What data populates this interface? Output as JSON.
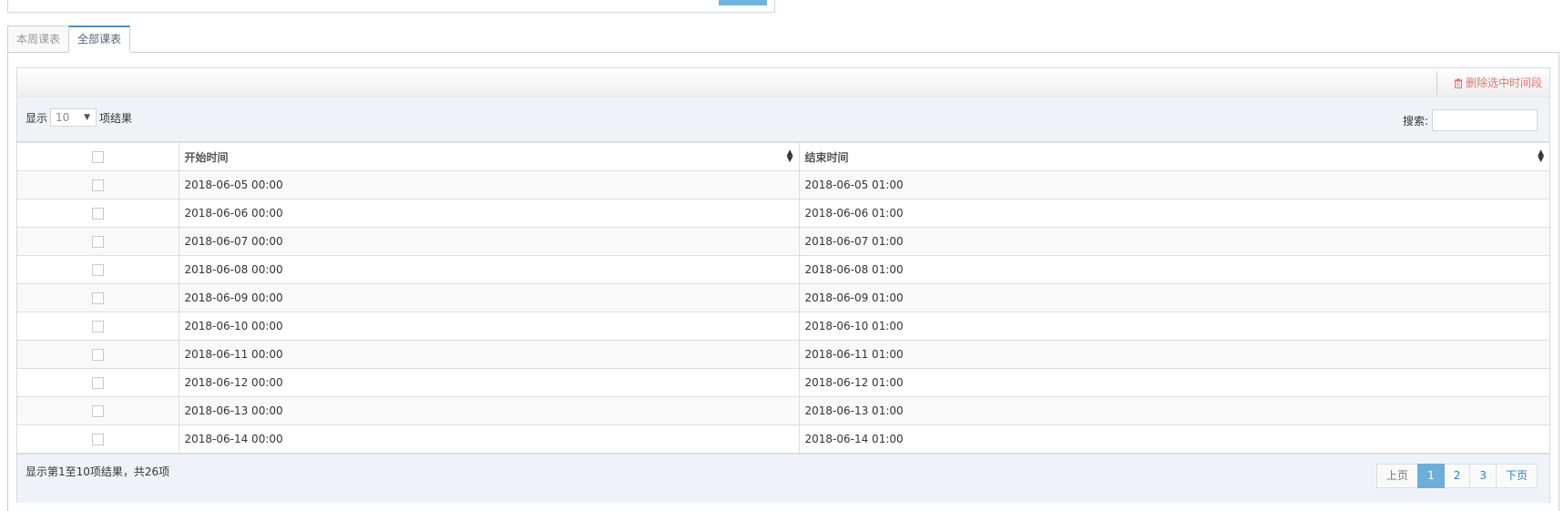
{
  "tabs": [
    {
      "label": "本周课表",
      "active": false
    },
    {
      "label": "全部课表",
      "active": true
    }
  ],
  "toolbar": {
    "delete_label": "删除选中时间段",
    "delete_color": "#e4726f"
  },
  "controls": {
    "show_prefix": "显示",
    "page_length": "10",
    "show_suffix": "项结果",
    "search_label": "搜索:",
    "search_value": ""
  },
  "table": {
    "headers": [
      "开始时间",
      "结束时间"
    ],
    "rows": [
      {
        "start": "2018-06-05 00:00",
        "end": "2018-06-05 01:00"
      },
      {
        "start": "2018-06-06 00:00",
        "end": "2018-06-06 01:00"
      },
      {
        "start": "2018-06-07 00:00",
        "end": "2018-06-07 01:00"
      },
      {
        "start": "2018-06-08 00:00",
        "end": "2018-06-08 01:00"
      },
      {
        "start": "2018-06-09 00:00",
        "end": "2018-06-09 01:00"
      },
      {
        "start": "2018-06-10 00:00",
        "end": "2018-06-10 01:00"
      },
      {
        "start": "2018-06-11 00:00",
        "end": "2018-06-11 01:00"
      },
      {
        "start": "2018-06-12 00:00",
        "end": "2018-06-12 01:00"
      },
      {
        "start": "2018-06-13 00:00",
        "end": "2018-06-13 01:00"
      },
      {
        "start": "2018-06-14 00:00",
        "end": "2018-06-14 01:00"
      }
    ]
  },
  "footer": {
    "info": "显示第1至10项结果，共26项",
    "prev_label": "上页",
    "pages": [
      "1",
      "2",
      "3"
    ],
    "current_page": "1",
    "next_label": "下页"
  },
  "colors": {
    "accent": "#6faed9",
    "tab_active_border": "#4c8fbd",
    "panel_bg": "#eff3f8"
  }
}
